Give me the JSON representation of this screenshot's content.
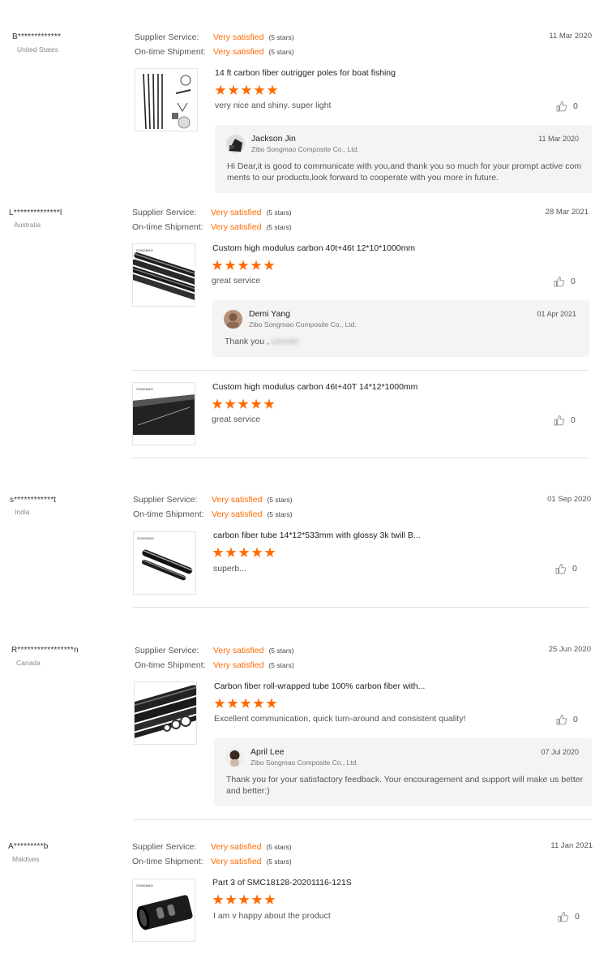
{
  "labels": {
    "supplier_service": "Supplier Service:",
    "ontime_shipment": "On-time Shipment:",
    "company": "Zibo Songmao Composite Co., Ltd."
  },
  "colors": {
    "accent": "#ff6a00",
    "reply_bg": "#f4f4f4",
    "divider": "#e2e2e2"
  },
  "icons": {
    "like": "thumbs-up-icon",
    "star": "star-icon"
  },
  "reviews": [
    {
      "buyer": "B*************",
      "country": "United States",
      "supplier_service": "Very satisfied",
      "supplier_service_stars": "(5 stars)",
      "ontime_shipment": "Very satisfied",
      "ontime_shipment_stars": "(5 stars)",
      "date": "11 Mar 2020",
      "products": [
        {
          "title": "14 ft carbon fiber outrigger poles for boat fishing",
          "rating": 5,
          "comment": "very nice and shiny. super light",
          "likes": "0",
          "reply": {
            "name": "Jackson Jin",
            "company": "Zibo Songmao Composite Co., Ltd.",
            "date": "11 Mar 2020",
            "line1": "Hi Dear,it is good to communicate with you,and thank you so much for your prompt active com",
            "line2": "ments to our products,look forward to cooperate with you more in future."
          }
        }
      ]
    },
    {
      "buyer": "L**************l",
      "country": "Australia",
      "supplier_service": "Very satisfied",
      "supplier_service_stars": "(5 stars)",
      "ontime_shipment": "Very satisfied",
      "ontime_shipment_stars": "(5 stars)",
      "date": "28 Mar 2021",
      "products": [
        {
          "title": "Custom high modulus carbon 40t+46t 12*10*1000mm",
          "rating": 5,
          "comment": "great service",
          "likes": "0",
          "reply": {
            "name": "Demi Yang",
            "company": "Zibo Songmao Composite Co., Ltd.",
            "date": "01 Apr 2021",
            "line1": "Thank you ,",
            "line1_blurred": "Lincoln"
          }
        },
        {
          "title": "Custom high modulus carbon 46t+40T 14*12*1000mm",
          "rating": 5,
          "comment": "great service",
          "likes": "0"
        }
      ]
    },
    {
      "buyer": "s************t",
      "country": "India",
      "supplier_service": "Very satisfied",
      "supplier_service_stars": "(5 stars)",
      "ontime_shipment": "Very satisfied",
      "ontime_shipment_stars": "(5 stars)",
      "date": "01 Sep 2020",
      "products": [
        {
          "title": "carbon fiber tube 14*12*533mm with glossy 3k twill B...",
          "rating": 5,
          "comment": "superb...",
          "likes": "0"
        }
      ]
    },
    {
      "buyer": "R*****************n",
      "country": "Canada",
      "supplier_service": "Very satisfied",
      "supplier_service_stars": "(5 stars)",
      "ontime_shipment": "Very satisfied",
      "ontime_shipment_stars": "(5 stars)",
      "date": "25 Jun 2020",
      "products": [
        {
          "title": "Carbon fiber roll-wrapped tube 100% carbon fiber with...",
          "rating": 5,
          "comment": "Excellent communication, quick turn-around and consistent quality!",
          "likes": "0",
          "reply": {
            "name": "April Lee",
            "company": "Zibo Songmao Composite Co., Ltd.",
            "date": "07 Jul 2020",
            "line1": "Thank you for your satisfactory feedback. Your encouragement and support will make us better",
            "line2": "and better:)"
          }
        }
      ]
    },
    {
      "buyer": "A*********b",
      "country": "Maldives",
      "supplier_service": "Very satisfied",
      "supplier_service_stars": "(5 stars)",
      "ontime_shipment": "Very satisfied",
      "ontime_shipment_stars": "(5 stars)",
      "date": "11 Jan 2021",
      "products": [
        {
          "title": "Part 3 of SMC18128-20201116-121S",
          "rating": 5,
          "comment": "I am v happy about the product",
          "likes": "0"
        }
      ]
    }
  ]
}
